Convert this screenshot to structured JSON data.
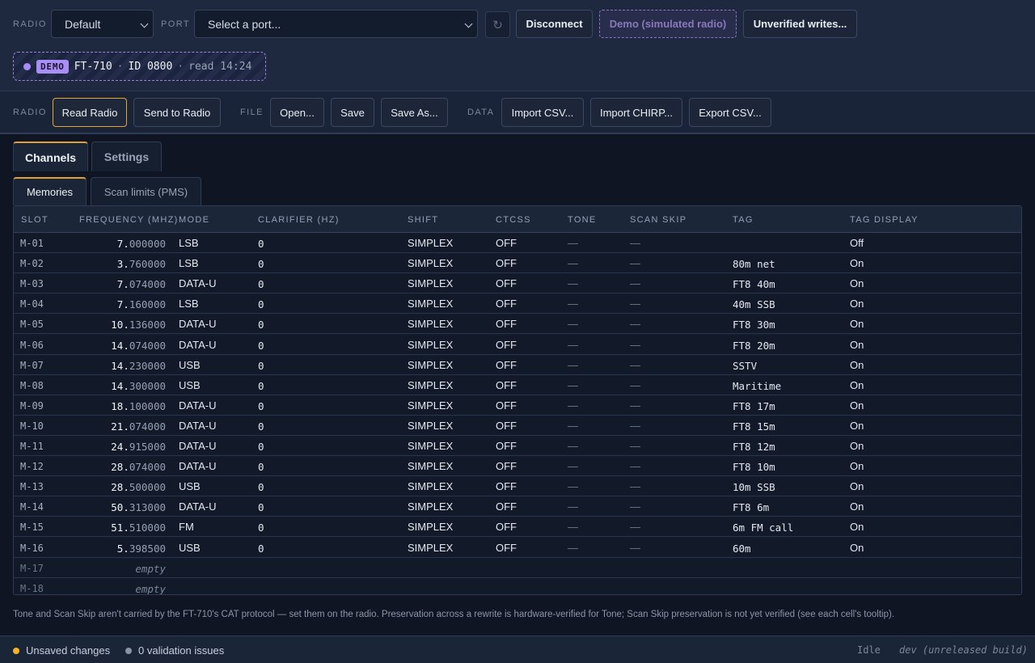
{
  "connection": {
    "radio_label": "RADIO",
    "radio_value": "Default",
    "port_label": "PORT",
    "port_placeholder": "Select a port...",
    "disconnect_label": "Disconnect",
    "demo_label": "Demo (simulated radio)",
    "unverified_label": "Unverified writes..."
  },
  "status_pill": {
    "badge": "DEMO",
    "model": "FT-710",
    "sep1": "·",
    "id": "ID 0800",
    "sep2": "·",
    "read": "read 14:24"
  },
  "toolbar": {
    "radio_group": "RADIO",
    "read_radio": "Read Radio",
    "send_to_radio": "Send to Radio",
    "file_group": "FILE",
    "open": "Open...",
    "save": "Save",
    "save_as": "Save As...",
    "data_group": "DATA",
    "import_csv": "Import CSV...",
    "import_chirp": "Import CHIRP...",
    "export_csv": "Export CSV..."
  },
  "tabs": [
    "Channels",
    "Settings"
  ],
  "subtabs": [
    "Memories",
    "Scan limits (PMS)"
  ],
  "table": {
    "headers": {
      "slot": "SLOT",
      "frequency": "FREQUENCY (MHZ)",
      "mode": "MODE",
      "clarifier": "CLARIFIER (HZ)",
      "shift": "SHIFT",
      "ctcss": "CTCSS",
      "tone": "TONE",
      "scan_skip": "SCAN SKIP",
      "tag": "TAG",
      "tag_display": "TAG DISPLAY"
    },
    "rows": [
      {
        "slot": "M-01",
        "freq_int": "7.",
        "freq_frac": "000000",
        "mode": "LSB",
        "clarifier": "0",
        "shift": "SIMPLEX",
        "ctcss": "OFF",
        "tone": "—",
        "scan_skip": "—",
        "tag": "",
        "tag_display": "Off"
      },
      {
        "slot": "M-02",
        "freq_int": "3.",
        "freq_frac": "760000",
        "mode": "LSB",
        "clarifier": "0",
        "shift": "SIMPLEX",
        "ctcss": "OFF",
        "tone": "—",
        "scan_skip": "—",
        "tag": "80m net",
        "tag_display": "On"
      },
      {
        "slot": "M-03",
        "freq_int": "7.",
        "freq_frac": "074000",
        "mode": "DATA-U",
        "clarifier": "0",
        "shift": "SIMPLEX",
        "ctcss": "OFF",
        "tone": "—",
        "scan_skip": "—",
        "tag": "FT8 40m",
        "tag_display": "On"
      },
      {
        "slot": "M-04",
        "freq_int": "7.",
        "freq_frac": "160000",
        "mode": "LSB",
        "clarifier": "0",
        "shift": "SIMPLEX",
        "ctcss": "OFF",
        "tone": "—",
        "scan_skip": "—",
        "tag": "40m SSB",
        "tag_display": "On"
      },
      {
        "slot": "M-05",
        "freq_int": "10.",
        "freq_frac": "136000",
        "mode": "DATA-U",
        "clarifier": "0",
        "shift": "SIMPLEX",
        "ctcss": "OFF",
        "tone": "—",
        "scan_skip": "—",
        "tag": "FT8 30m",
        "tag_display": "On"
      },
      {
        "slot": "M-06",
        "freq_int": "14.",
        "freq_frac": "074000",
        "mode": "DATA-U",
        "clarifier": "0",
        "shift": "SIMPLEX",
        "ctcss": "OFF",
        "tone": "—",
        "scan_skip": "—",
        "tag": "FT8 20m",
        "tag_display": "On"
      },
      {
        "slot": "M-07",
        "freq_int": "14.",
        "freq_frac": "230000",
        "mode": "USB",
        "clarifier": "0",
        "shift": "SIMPLEX",
        "ctcss": "OFF",
        "tone": "—",
        "scan_skip": "—",
        "tag": "SSTV",
        "tag_display": "On"
      },
      {
        "slot": "M-08",
        "freq_int": "14.",
        "freq_frac": "300000",
        "mode": "USB",
        "clarifier": "0",
        "shift": "SIMPLEX",
        "ctcss": "OFF",
        "tone": "—",
        "scan_skip": "—",
        "tag": "Maritime",
        "tag_display": "On"
      },
      {
        "slot": "M-09",
        "freq_int": "18.",
        "freq_frac": "100000",
        "mode": "DATA-U",
        "clarifier": "0",
        "shift": "SIMPLEX",
        "ctcss": "OFF",
        "tone": "—",
        "scan_skip": "—",
        "tag": "FT8 17m",
        "tag_display": "On"
      },
      {
        "slot": "M-10",
        "freq_int": "21.",
        "freq_frac": "074000",
        "mode": "DATA-U",
        "clarifier": "0",
        "shift": "SIMPLEX",
        "ctcss": "OFF",
        "tone": "—",
        "scan_skip": "—",
        "tag": "FT8 15m",
        "tag_display": "On"
      },
      {
        "slot": "M-11",
        "freq_int": "24.",
        "freq_frac": "915000",
        "mode": "DATA-U",
        "clarifier": "0",
        "shift": "SIMPLEX",
        "ctcss": "OFF",
        "tone": "—",
        "scan_skip": "—",
        "tag": "FT8 12m",
        "tag_display": "On"
      },
      {
        "slot": "M-12",
        "freq_int": "28.",
        "freq_frac": "074000",
        "mode": "DATA-U",
        "clarifier": "0",
        "shift": "SIMPLEX",
        "ctcss": "OFF",
        "tone": "—",
        "scan_skip": "—",
        "tag": "FT8 10m",
        "tag_display": "On"
      },
      {
        "slot": "M-13",
        "freq_int": "28.",
        "freq_frac": "500000",
        "mode": "USB",
        "clarifier": "0",
        "shift": "SIMPLEX",
        "ctcss": "OFF",
        "tone": "—",
        "scan_skip": "—",
        "tag": "10m SSB",
        "tag_display": "On"
      },
      {
        "slot": "M-14",
        "freq_int": "50.",
        "freq_frac": "313000",
        "mode": "DATA-U",
        "clarifier": "0",
        "shift": "SIMPLEX",
        "ctcss": "OFF",
        "tone": "—",
        "scan_skip": "—",
        "tag": "FT8 6m",
        "tag_display": "On"
      },
      {
        "slot": "M-15",
        "freq_int": "51.",
        "freq_frac": "510000",
        "mode": "FM",
        "clarifier": "0",
        "shift": "SIMPLEX",
        "ctcss": "OFF",
        "tone": "—",
        "scan_skip": "—",
        "tag": "6m FM call",
        "tag_display": "On"
      },
      {
        "slot": "M-16",
        "freq_int": "5.",
        "freq_frac": "398500",
        "mode": "USB",
        "clarifier": "0",
        "shift": "SIMPLEX",
        "ctcss": "OFF",
        "tone": "—",
        "scan_skip": "—",
        "tag": "60m",
        "tag_display": "On"
      }
    ],
    "empty_rows": [
      {
        "slot": "M-17",
        "freq": "empty"
      },
      {
        "slot": "M-18",
        "freq": "empty"
      }
    ]
  },
  "footnote": "Tone and Scan Skip aren't carried by the FT-710's CAT protocol — set them on the radio. Preservation across a rewrite is hardware-verified for Tone; Scan Skip preservation is not yet verified (see each cell's tooltip).",
  "statusbar": {
    "unsaved": "Unsaved changes",
    "validation": "0 validation issues",
    "state": "Idle",
    "build": "dev (unreleased build)"
  },
  "colors": {
    "accent": "#e0a13a",
    "demo_purple": "#a88ef5",
    "unsaved_dot": "#f5b323",
    "validation_dot": "#8a93a5"
  }
}
